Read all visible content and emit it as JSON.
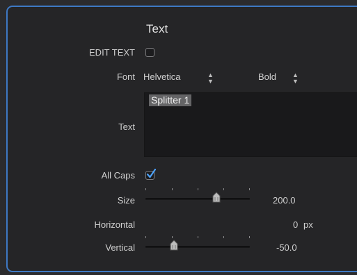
{
  "section": {
    "title": "Text"
  },
  "edit_text": {
    "label": "EDIT TEXT",
    "checked": false
  },
  "font": {
    "label": "Font",
    "family": "Helvetica",
    "style": "Bold"
  },
  "text": {
    "label": "Text",
    "content": "Splitter 1"
  },
  "all_caps": {
    "label": "All Caps",
    "checked": true
  },
  "size": {
    "label": "Size",
    "value": "200.0",
    "slider_fraction": 0.68
  },
  "horizontal": {
    "label": "Horizontal",
    "value": "0",
    "unit": "px"
  },
  "vertical": {
    "label": "Vertical",
    "value": "-50.0",
    "slider_fraction": 0.28
  },
  "colors": {
    "accent": "#3e79c4",
    "checkmark": "#4da3ff"
  }
}
